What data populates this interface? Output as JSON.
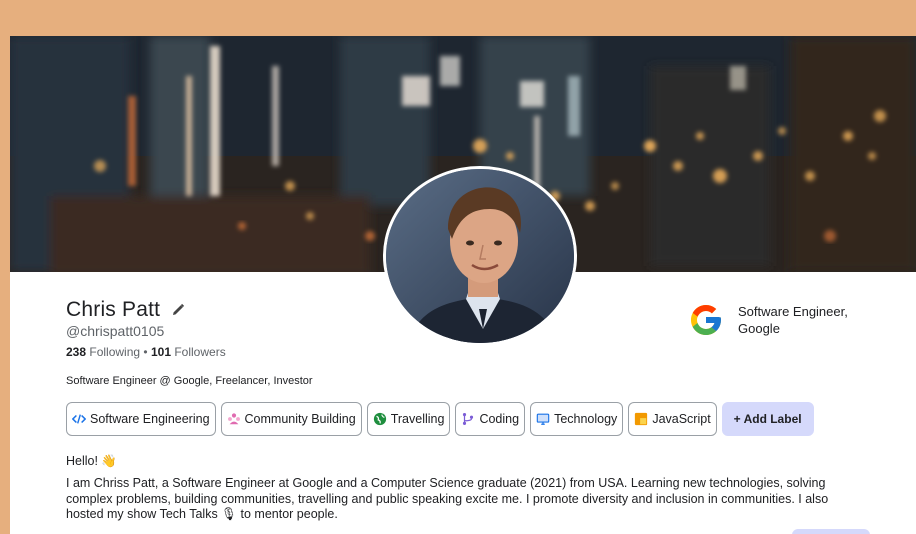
{
  "profile": {
    "name": "Chris Patt",
    "handle": "@chrispatt0105",
    "following_count": "238",
    "following_label": "Following",
    "separator": "•",
    "followers_count": "101",
    "followers_label": "Followers",
    "headline": "Software Engineer @ Google, Freelancer, Investor"
  },
  "company": {
    "title": "Software Engineer, Google",
    "logo_icon": "google-logo-icon"
  },
  "labels": [
    {
      "text": "Software Engineering",
      "icon": "code-icon",
      "color": "#1a73e8"
    },
    {
      "text": "Community Building",
      "icon": "community-icon",
      "color": "#e06bb0"
    },
    {
      "text": "Travelling",
      "icon": "globe-icon",
      "color": "#1e8e3e"
    },
    {
      "text": "Coding",
      "icon": "branch-icon",
      "color": "#7b5cd6"
    },
    {
      "text": "Technology",
      "icon": "monitor-icon",
      "color": "#1a73e8"
    },
    {
      "text": "JavaScript",
      "icon": "js-icon",
      "color": "#f29900"
    }
  ],
  "add_label": "+ Add Label",
  "about": {
    "greeting": "Hello! 👋",
    "bio": "I am Chriss Patt, a Software Engineer at Google and a Computer Science graduate (2021) from USA. Learning new technologies, solving complex problems, building communities, travelling and public speaking excite me. I promote diversity and inclusion in communities. I also hosted my show Tech Talks 🎙 to mentor people."
  },
  "colors": {
    "frame": "#E6AF7E",
    "accent": "#d5d9fb"
  }
}
